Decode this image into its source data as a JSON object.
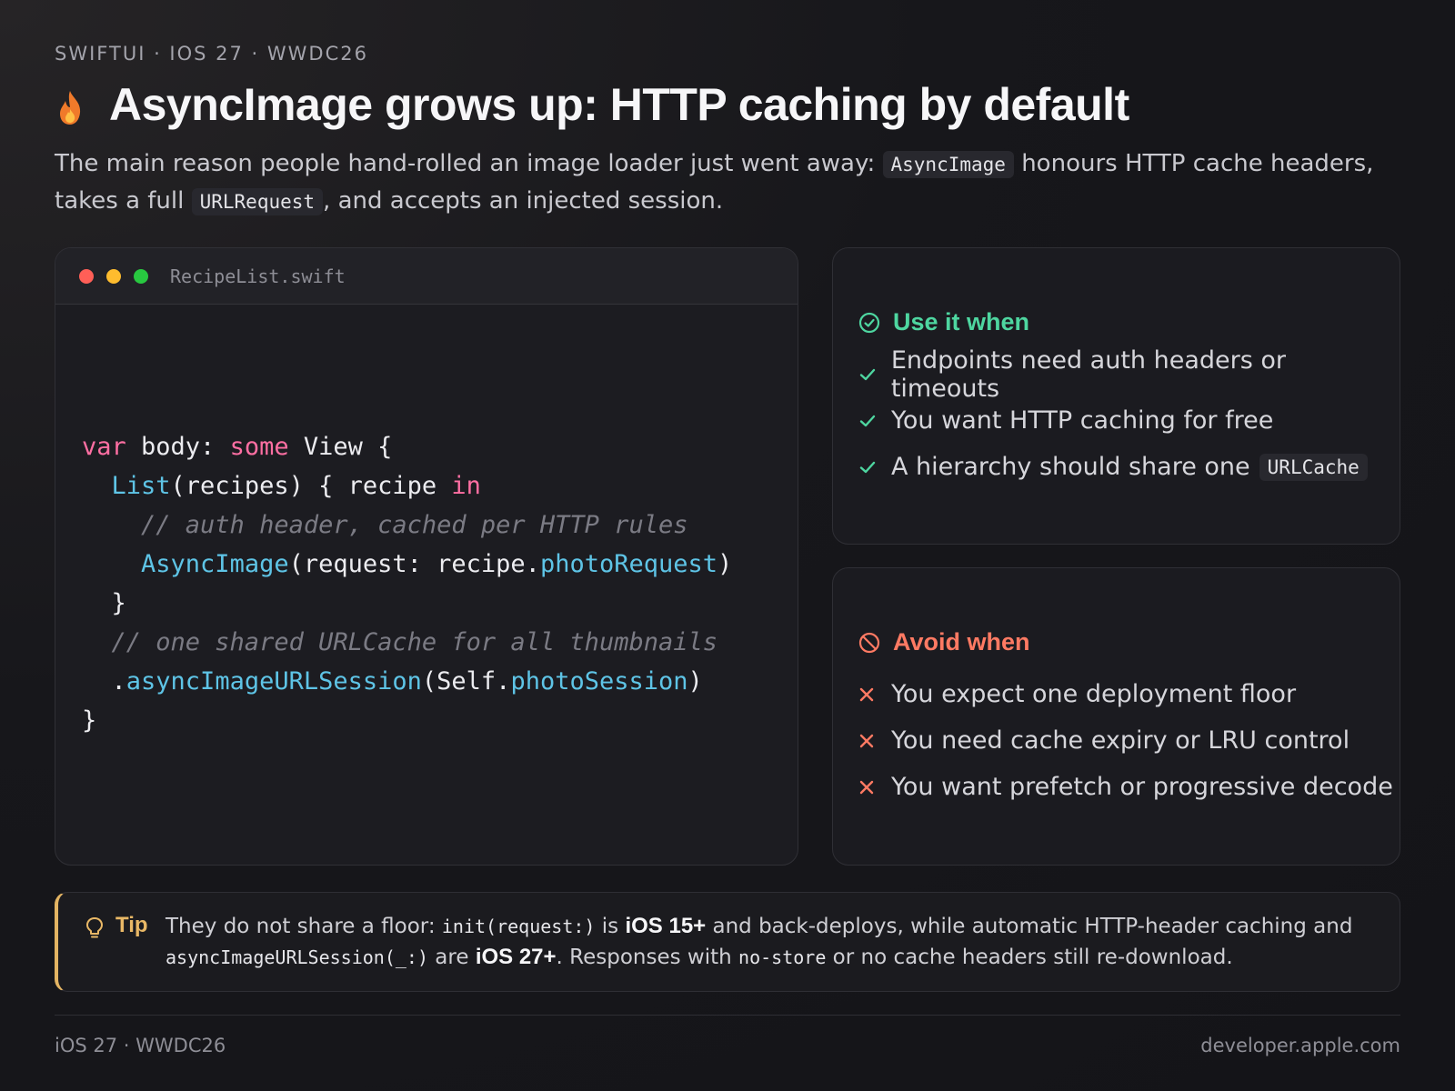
{
  "eyebrow": "SWIFTUI · IOS 27 · WWDC26",
  "title": "AsyncImage grows up: HTTP caching by default",
  "subtitle": {
    "part1": "The main reason people hand-rolled an image loader just went away: ",
    "code1": "AsyncImage",
    "part2": " honours HTTP cache headers, takes a full ",
    "code2": "URLRequest",
    "part3": ", and accepts an injected session."
  },
  "code_panel": {
    "filename": "RecipeList.swift",
    "lines": {
      "l1_var": "var",
      "l1_body": " body: ",
      "l1_some": "some",
      "l1_rest": " View {",
      "l2_indent": "  ",
      "l2_list": "List",
      "l2_rest": "(recipes) { recipe ",
      "l2_in": "in",
      "l3_comment": "    // auth header, cached per HTTP rules",
      "l4_indent": "    ",
      "l4_fn": "AsyncImage",
      "l4_mid": "(request: recipe.",
      "l4_prop": "photoRequest",
      "l4_end": ")",
      "l5": "  }",
      "l6_comment": "  // one shared URLCache for all thumbnails",
      "l7_dot": "  .",
      "l7_fn": "asyncImageURLSession",
      "l7_mid": "(Self.",
      "l7_prop": "photoSession",
      "l7_end": ")",
      "l8": "}"
    }
  },
  "use_card": {
    "heading": "Use it when",
    "items": [
      "Endpoints need auth headers or timeouts",
      "You want HTTP caching for free",
      "A hierarchy should share one "
    ],
    "item3_code": "URLCache",
    "color": "#4ed6a0"
  },
  "avoid_card": {
    "heading": "Avoid when",
    "items": [
      "You expect one deployment floor",
      "You need cache expiry or LRU control",
      "You want prefetch or progressive decode"
    ],
    "color": "#ff7a63"
  },
  "tip": {
    "label": "Tip",
    "t1": "They do not share a floor: ",
    "c1": "init(request:)",
    "t2": " is ",
    "b1": "iOS 15+",
    "t3": " and back-deploys, while automatic HTTP-header caching and ",
    "c2": "asyncImageURLSession(_:)",
    "t4": " are ",
    "b2": "iOS 27+",
    "t5": ". Responses with ",
    "c3": "no-store",
    "t6": " or no cache headers still re-download.",
    "color": "#e3b463"
  },
  "footer": {
    "left": "iOS 27 · WWDC26",
    "right": "developer.apple.com"
  },
  "icons": {
    "title": "flame-icon",
    "use": "check-circle-icon",
    "avoid": "prohibited-icon",
    "tip": "lightbulb-icon"
  }
}
